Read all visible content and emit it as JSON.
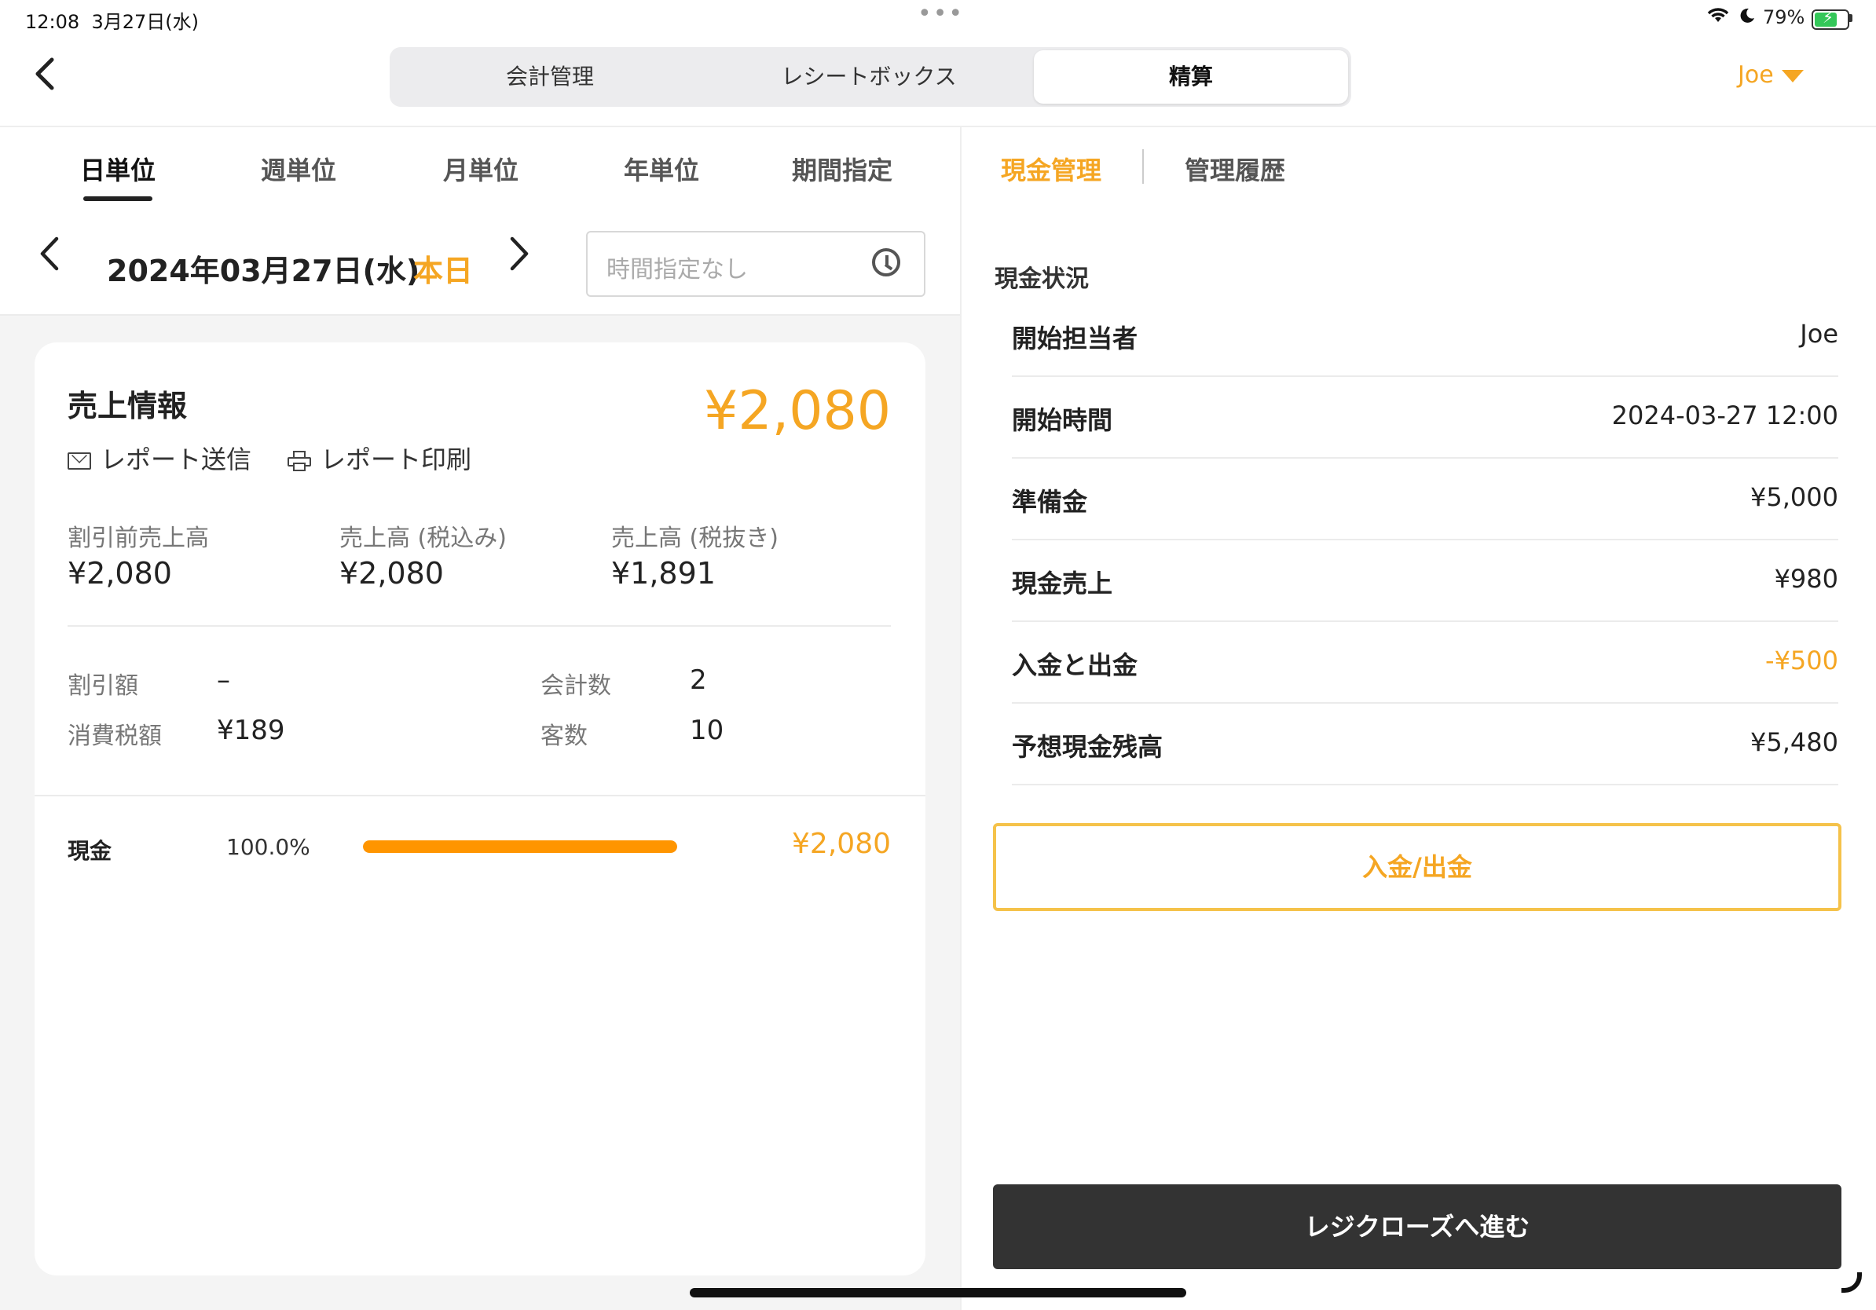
{
  "status_bar": {
    "time": "12:08",
    "date": "3月27日(水)",
    "dots": "•••",
    "battery": "79%",
    "battery_level_pct": 79,
    "battery_color": "#34C759"
  },
  "header": {
    "back": "‹",
    "segments": [
      {
        "label": "会計管理",
        "active": false
      },
      {
        "label": "レシートボックス",
        "active": false
      },
      {
        "label": "精算",
        "active": true
      }
    ],
    "user": "Joe"
  },
  "period_tabs": [
    "日単位",
    "週単位",
    "月単位",
    "年単位",
    "期間指定"
  ],
  "date_nav": {
    "prev": "‹",
    "next": "›",
    "date": "2024年03月27日(水)",
    "today": "本日",
    "time_filter_placeholder": "時間指定なし"
  },
  "sales_info": {
    "title": "売上情報",
    "total": "¥2,080",
    "send_report": "レポート送信",
    "print_report": "レポート印刷",
    "metrics": [
      {
        "label": "割引前売上高",
        "value": "¥2,080"
      },
      {
        "label": "売上高 (税込み)",
        "value": "¥2,080"
      },
      {
        "label": "売上高 (税抜き)",
        "value": "¥1,891"
      }
    ],
    "stats": {
      "discount_label": "割引額",
      "discount_value": "–",
      "tax_label": "消費税額",
      "tax_value": "¥189",
      "checkout_label": "会計数",
      "checkout_value": "2",
      "customers_label": "客数",
      "customers_value": "10"
    },
    "payment": {
      "method": "現金",
      "percent_text": "100.0%",
      "fraction": 1.0,
      "amount": "¥2,080"
    }
  },
  "right_tabs": {
    "cash": "現金管理",
    "history": "管理履歴"
  },
  "cash_status": {
    "title": "現金状況",
    "rows": [
      {
        "label": "開始担当者",
        "value": "Joe"
      },
      {
        "label": "開始時間",
        "value": "2024-03-27 12:00"
      },
      {
        "label": "準備金",
        "value": "¥5,000"
      },
      {
        "label": "現金売上",
        "value": "¥980"
      },
      {
        "label": "入金と出金",
        "value": "-¥500"
      },
      {
        "label": "予想現金残高",
        "value": "¥5,480"
      }
    ]
  },
  "buttons": {
    "deposit": "入金/出金",
    "close": "レジクローズへ進む"
  },
  "colors": {
    "accent": "#F5A623",
    "bar": "#FF9500",
    "dark_button": "#333333"
  }
}
